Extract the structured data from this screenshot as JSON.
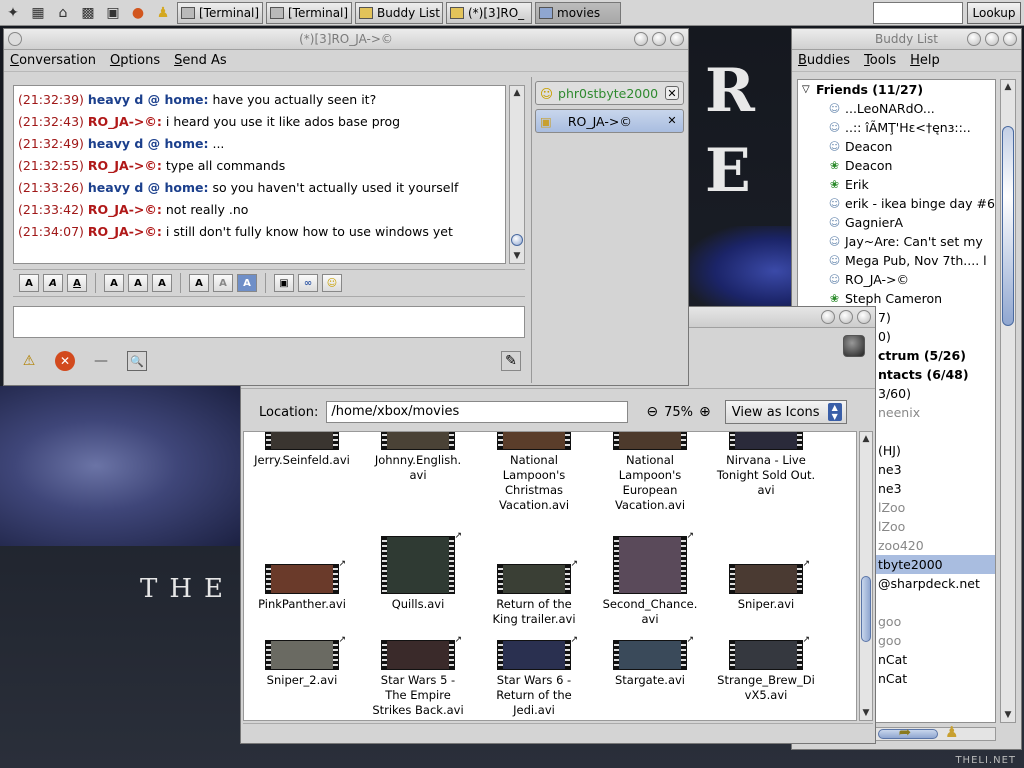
{
  "panel": {
    "launchers": [
      "app-menu-icon",
      "desktop-icon",
      "home-icon",
      "camera-icon",
      "terminal-icon",
      "firefox-icon",
      "gaim-icon"
    ],
    "tasks": [
      {
        "label": "[Terminal]",
        "icon": "terminal-icon"
      },
      {
        "label": "[Terminal]",
        "icon": "terminal-icon"
      },
      {
        "label": "Buddy List",
        "icon": "buddy-icon"
      },
      {
        "label": "(*)[3]RO_",
        "icon": "buddy-icon"
      },
      {
        "label": "movies",
        "icon": "folder-icon"
      }
    ],
    "lookup_label": "Lookup"
  },
  "conversation": {
    "title": "(*)[3]RO_JA->©",
    "menu": [
      "Conversation",
      "Options",
      "Send As"
    ],
    "messages": [
      {
        "time": "(21:32:39)",
        "sender": "heavy d @ home:",
        "text": "have you actually seen it?",
        "from": "me"
      },
      {
        "time": "(21:32:43)",
        "sender": "RO_JA->©:",
        "text": "i heard you use it like ados base prog",
        "from": "them"
      },
      {
        "time": "(21:32:49)",
        "sender": "heavy d @ home:",
        "text": "...",
        "from": "me"
      },
      {
        "time": "(21:32:55)",
        "sender": "RO_JA->©:",
        "text": "type all commands",
        "from": "them"
      },
      {
        "time": "(21:33:26)",
        "sender": "heavy d @ home:",
        "text": "so you haven't actually used it yourself",
        "from": "me"
      },
      {
        "time": "(21:33:42)",
        "sender": "RO_JA->©:",
        "text": "not really .no",
        "from": "them"
      },
      {
        "time": "(21:34:07)",
        "sender": "RO_JA->©:",
        "text": "i still don't fully know how to use windows yet",
        "from": "them"
      }
    ],
    "tabs": [
      {
        "label": "phr0stbyte2000",
        "selected": false
      },
      {
        "label": "RO_JA->©",
        "selected": true
      }
    ]
  },
  "buddylist": {
    "title": "Buddy List",
    "menu": [
      "Buddies",
      "Tools",
      "Help"
    ],
    "rows": [
      {
        "type": "group",
        "label": "Friends (11/27)"
      },
      {
        "type": "item",
        "label": "...LeoNARdO...",
        "icon": "person"
      },
      {
        "type": "item",
        "label": "..:: îÃMŢ'Hɛ<†ęnɜ::..",
        "icon": "person"
      },
      {
        "type": "item",
        "label": "Deacon",
        "icon": "person"
      },
      {
        "type": "item",
        "label": "Deacon",
        "icon": "flower"
      },
      {
        "type": "item",
        "label": "Erik",
        "icon": "flower"
      },
      {
        "type": "item",
        "label": "erik - ikea binge day #6",
        "icon": "person"
      },
      {
        "type": "item",
        "label": "GagnierA",
        "icon": "person"
      },
      {
        "type": "item",
        "label": "Jay~Are: Can't set my",
        "icon": "person"
      },
      {
        "type": "item",
        "label": "Mega Pub, Nov 7th.... l",
        "icon": "person"
      },
      {
        "type": "item",
        "label": "RO_JA->©",
        "icon": "person"
      },
      {
        "type": "item",
        "label": "Steph Cameron",
        "icon": "flower"
      },
      {
        "type": "partial",
        "label": "7)"
      },
      {
        "type": "partial",
        "label": "0)"
      },
      {
        "type": "partialbold",
        "label": "ctrum (5/26)"
      },
      {
        "type": "partialbold",
        "label": "ntacts (6/48)"
      },
      {
        "type": "partial",
        "label": "3/60)"
      },
      {
        "type": "partialdim",
        "label": "neenix"
      },
      {
        "type": "partial",
        "label": ""
      },
      {
        "type": "partial",
        "label": "(HJ)"
      },
      {
        "type": "partial",
        "label": "ne3"
      },
      {
        "type": "partial",
        "label": "ne3"
      },
      {
        "type": "partialdim",
        "label": "lZoo"
      },
      {
        "type": "partialdim",
        "label": "lZoo"
      },
      {
        "type": "partialdim",
        "label": "zoo420"
      },
      {
        "type": "partialsel",
        "label": "tbyte2000"
      },
      {
        "type": "partial",
        "label": "@sharpdeck.net"
      },
      {
        "type": "partial",
        "label": ""
      },
      {
        "type": "partialdim",
        "label": "goo"
      },
      {
        "type": "partialdim",
        "label": "goo"
      },
      {
        "type": "partial",
        "label": "nCat"
      },
      {
        "type": "partial",
        "label": "nCat"
      }
    ]
  },
  "filemanager": {
    "location_label": "Location:",
    "location_value": "/home/xbox/movies",
    "zoom": "75%",
    "view_mode": "View as Icons",
    "files": [
      {
        "name": "Jerry.Seinfeld.avi",
        "lines": [
          "Jerry.Seinfeld.avi"
        ],
        "thumb": "#3a3530"
      },
      {
        "name": "Johnny.English.avi",
        "lines": [
          "Johnny.English.",
          "avi"
        ],
        "thumb": "#4a4236"
      },
      {
        "name": "National Lampoon's Christmas Vacation.avi",
        "lines": [
          "National",
          "Lampoon's",
          "Christmas",
          "Vacation.avi"
        ],
        "thumb": "#5a3d2a"
      },
      {
        "name": "National Lampoon's European Vacation.avi",
        "lines": [
          "National",
          "Lampoon's",
          "European",
          "Vacation.avi"
        ],
        "thumb": "#4d3a2c"
      },
      {
        "name": "Nirvana - Live Tonight Sold Out.avi",
        "lines": [
          "Nirvana - Live",
          "Tonight Sold Out.",
          "avi"
        ],
        "thumb": "#2a2a3a"
      },
      {
        "name": "PinkPanther.avi",
        "lines": [
          "PinkPanther.avi"
        ],
        "thumb": "#6a3a2a"
      },
      {
        "name": "Quills.avi",
        "lines": [
          "Quills.avi"
        ],
        "thumb": "#2f3a33"
      },
      {
        "name": "Return of the King trailer.avi",
        "lines": [
          "Return of the",
          "King trailer.avi"
        ],
        "thumb": "#3a3f35"
      },
      {
        "name": "Second_Chance.avi",
        "lines": [
          "Second_Chance.",
          "avi"
        ],
        "thumb": "#5a4a5a"
      },
      {
        "name": "Sniper.avi",
        "lines": [
          "Sniper.avi"
        ],
        "thumb": "#4a3a32"
      },
      {
        "name": "Sniper_2.avi",
        "lines": [
          "Sniper_2.avi"
        ],
        "thumb": "#6a6a62"
      },
      {
        "name": "Star Wars 5 - The Empire Strikes Back.avi",
        "lines": [
          "Star Wars 5 -",
          "The Empire",
          "Strikes Back.avi"
        ],
        "thumb": "#3a2a2a"
      },
      {
        "name": "Star Wars 6 - Return of the Jedi.avi",
        "lines": [
          "Star Wars 6 -",
          "Return of the",
          "Jedi.avi"
        ],
        "thumb": "#2a3050"
      },
      {
        "name": "Stargate.avi",
        "lines": [
          "Stargate.avi"
        ],
        "thumb": "#3a4a5a"
      },
      {
        "name": "Strange_Brew_DivX5.avi",
        "lines": [
          "Strange_Brew_Di",
          "vX5.avi"
        ],
        "thumb": "#35383f"
      }
    ]
  },
  "wallpaper": {
    "footer": "THELI.NET",
    "the": "THE"
  }
}
